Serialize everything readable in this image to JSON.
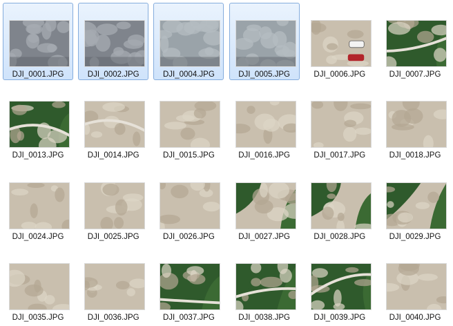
{
  "files": [
    {
      "name": "DJI_0001.JPG",
      "selected": true,
      "scene": "rock-closeup-grey"
    },
    {
      "name": "DJI_0002.JPG",
      "selected": true,
      "scene": "rock-closeup-grey"
    },
    {
      "name": "DJI_0004.JPG",
      "selected": true,
      "scene": "rock-closeup-blurred"
    },
    {
      "name": "DJI_0005.JPG",
      "selected": true,
      "scene": "rock-closeup-blurred"
    },
    {
      "name": "DJI_0006.JPG",
      "selected": false,
      "scene": "aerial-cars"
    },
    {
      "name": "DJI_0007.JPG",
      "selected": false,
      "scene": "aerial-road-forest"
    },
    {
      "name": "DJI_0013.JPG",
      "selected": false,
      "scene": "aerial-forest-road"
    },
    {
      "name": "DJI_0014.JPG",
      "selected": false,
      "scene": "aerial-quarry-road"
    },
    {
      "name": "DJI_0015.JPG",
      "selected": false,
      "scene": "aerial-quarry"
    },
    {
      "name": "DJI_0016.JPG",
      "selected": false,
      "scene": "aerial-quarry"
    },
    {
      "name": "DJI_0017.JPG",
      "selected": false,
      "scene": "aerial-quarry"
    },
    {
      "name": "DJI_0018.JPG",
      "selected": false,
      "scene": "aerial-quarry"
    },
    {
      "name": "DJI_0024.JPG",
      "selected": false,
      "scene": "aerial-quarry"
    },
    {
      "name": "DJI_0025.JPG",
      "selected": false,
      "scene": "aerial-quarry"
    },
    {
      "name": "DJI_0026.JPG",
      "selected": false,
      "scene": "aerial-quarry"
    },
    {
      "name": "DJI_0027.JPG",
      "selected": false,
      "scene": "aerial-quarry-forest"
    },
    {
      "name": "DJI_0028.JPG",
      "selected": false,
      "scene": "aerial-quarry-forest"
    },
    {
      "name": "DJI_0029.JPG",
      "selected": false,
      "scene": "aerial-quarry-forest"
    },
    {
      "name": "DJI_0035.JPG",
      "selected": false,
      "scene": "aerial-quarry"
    },
    {
      "name": "DJI_0036.JPG",
      "selected": false,
      "scene": "aerial-quarry"
    },
    {
      "name": "DJI_0037.JPG",
      "selected": false,
      "scene": "aerial-forest-road"
    },
    {
      "name": "DJI_0038.JPG",
      "selected": false,
      "scene": "aerial-forest-road"
    },
    {
      "name": "DJI_0039.JPG",
      "selected": false,
      "scene": "aerial-forest-road"
    },
    {
      "name": "DJI_0040.JPG",
      "selected": false,
      "scene": "aerial-quarry"
    }
  ],
  "colors": {
    "selection_border": "#84acdd",
    "selection_fill": "#d7e8fc",
    "rock_grey": "#8f939a",
    "quarry_tan": "#c9bfae",
    "forest_green": "#2f5a2c",
    "road_light": "#e6e1d8"
  }
}
